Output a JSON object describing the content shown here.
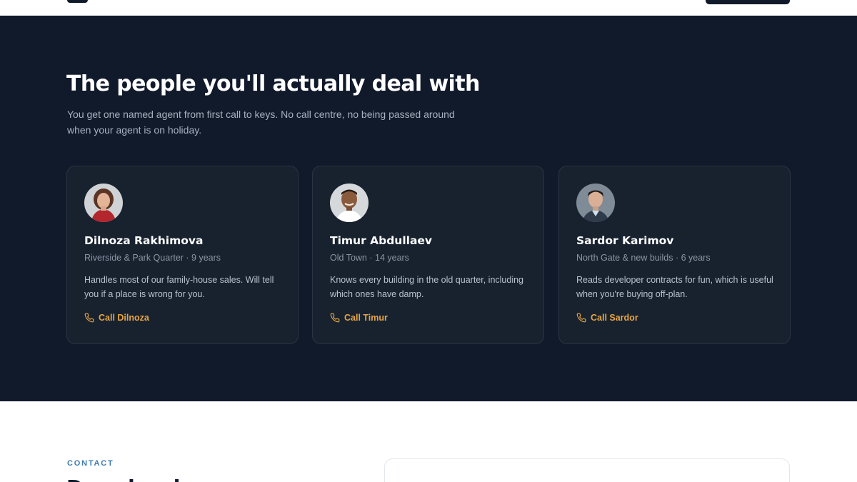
{
  "team": {
    "heading": "The people you'll actually deal with",
    "lead": "You get one named agent from first call to keys. No call centre, no being passed around when your agent is on holiday.",
    "agents": [
      {
        "name": "Dilnoza Rakhimova",
        "meta": "Riverside & Park Quarter · 9 years",
        "description": "Handles most of our family-house sales. Will tell you if a place is wrong for you.",
        "call_label": "Call Dilnoza",
        "icon": "phone-icon"
      },
      {
        "name": "Timur Abdullaev",
        "meta": "Old Town · 14 years",
        "description": "Knows every building in the old quarter, including which ones have damp.",
        "call_label": "Call Timur",
        "icon": "phone-icon"
      },
      {
        "name": "Sardor Karimov",
        "meta": "North Gate & new builds · 6 years",
        "description": "Reads developer contracts for fun, which is useful when you're buying off-plan.",
        "call_label": "Call Sardor",
        "icon": "phone-icon"
      }
    ]
  },
  "contact": {
    "eyebrow": "CONTACT",
    "heading": "Drop in, ring"
  },
  "colors": {
    "section_bg": "#111a2b",
    "card_bg": "#18222f",
    "accent": "#e7a541",
    "eyebrow": "#3d7bb0"
  }
}
